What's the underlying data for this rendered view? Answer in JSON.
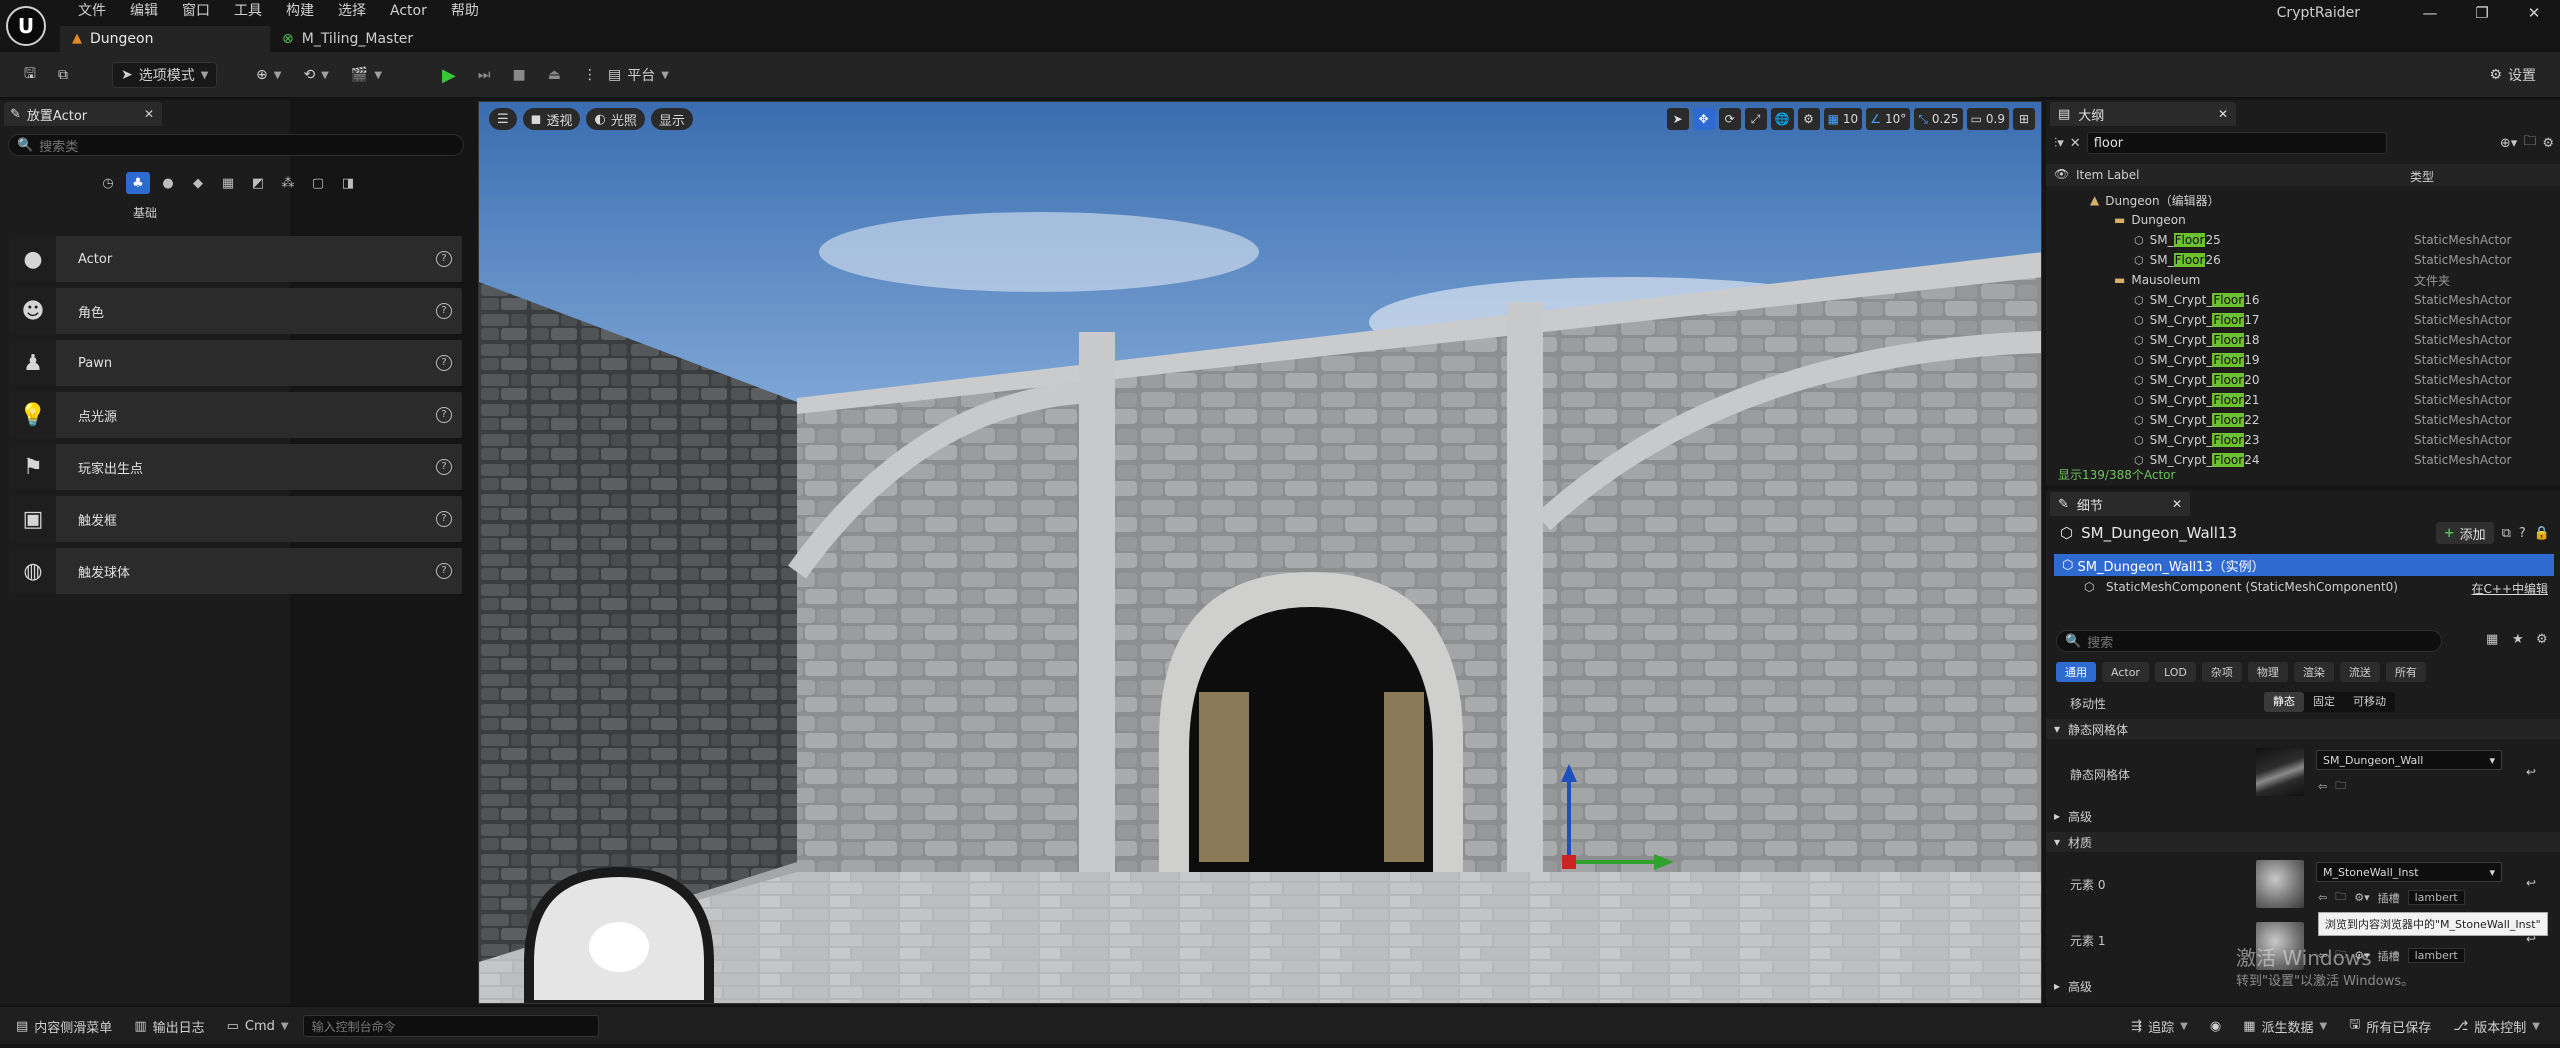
{
  "titlebar": {
    "logo": "U",
    "menu": [
      "文件",
      "编辑",
      "窗口",
      "工具",
      "构建",
      "选择",
      "Actor",
      "帮助"
    ],
    "app_name": "CryptRaider",
    "window_controls": [
      "—",
      "❐",
      "✕"
    ]
  },
  "tabs": [
    {
      "label": "Dungeon",
      "icon": "level-icon"
    },
    {
      "label": "M_Tiling_Master",
      "icon": "material-icon"
    }
  ],
  "toolbar": {
    "mode_label": "选项模式",
    "platform_label": "平台",
    "settings_label": "设置"
  },
  "place_actors": {
    "tab_label": "放置Actor",
    "search_placeholder": "搜索类",
    "category": "基础",
    "items": [
      {
        "label": "Actor",
        "icon": "sphere-icon"
      },
      {
        "label": "角色",
        "icon": "character-icon"
      },
      {
        "label": "Pawn",
        "icon": "pawn-icon"
      },
      {
        "label": "点光源",
        "icon": "point-light-icon"
      },
      {
        "label": "玩家出生点",
        "icon": "player-start-icon"
      },
      {
        "label": "触发框",
        "icon": "trigger-box-icon"
      },
      {
        "label": "触发球体",
        "icon": "trigger-sphere-icon"
      }
    ]
  },
  "viewport": {
    "perspective_label": "透视",
    "lighting_label": "光照",
    "show_label": "显示",
    "grid_snap": "10",
    "rotation_snap": "10°",
    "scale_snap": "0.25",
    "camera_speed": "0.9"
  },
  "outliner": {
    "tab_label": "大纲",
    "filter_value": "floor",
    "col_label": "Item Label",
    "col_type": "类型",
    "root": "Dungeon（编辑器）",
    "rows": [
      {
        "pre": "",
        "hl": "",
        "post": "Dungeon",
        "type": "",
        "kind": "folder",
        "indent": 1
      },
      {
        "pre": "SM_",
        "hl": "Floor",
        "post": "25",
        "type": "StaticMeshActor",
        "kind": "mesh",
        "indent": 2
      },
      {
        "pre": "SM_",
        "hl": "Floor",
        "post": "26",
        "type": "StaticMeshActor",
        "kind": "mesh",
        "indent": 2
      },
      {
        "pre": "",
        "hl": "",
        "post": "Mausoleum",
        "type": "文件夹",
        "kind": "folder",
        "indent": 1
      },
      {
        "pre": "SM_Crypt_",
        "hl": "Floor",
        "post": "16",
        "type": "StaticMeshActor",
        "kind": "mesh",
        "indent": 2
      },
      {
        "pre": "SM_Crypt_",
        "hl": "Floor",
        "post": "17",
        "type": "StaticMeshActor",
        "kind": "mesh",
        "indent": 2
      },
      {
        "pre": "SM_Crypt_",
        "hl": "Floor",
        "post": "18",
        "type": "StaticMeshActor",
        "kind": "mesh",
        "indent": 2
      },
      {
        "pre": "SM_Crypt_",
        "hl": "Floor",
        "post": "19",
        "type": "StaticMeshActor",
        "kind": "mesh",
        "indent": 2
      },
      {
        "pre": "SM_Crypt_",
        "hl": "Floor",
        "post": "20",
        "type": "StaticMeshActor",
        "kind": "mesh",
        "indent": 2
      },
      {
        "pre": "SM_Crypt_",
        "hl": "Floor",
        "post": "21",
        "type": "StaticMeshActor",
        "kind": "mesh",
        "indent": 2
      },
      {
        "pre": "SM_Crypt_",
        "hl": "Floor",
        "post": "22",
        "type": "StaticMeshActor",
        "kind": "mesh",
        "indent": 2
      },
      {
        "pre": "SM_Crypt_",
        "hl": "Floor",
        "post": "23",
        "type": "StaticMeshActor",
        "kind": "mesh",
        "indent": 2
      },
      {
        "pre": "SM_Crypt_",
        "hl": "Floor",
        "post": "24",
        "type": "StaticMeshActor",
        "kind": "mesh",
        "indent": 2
      }
    ],
    "footer": "显示139/388个Actor"
  },
  "details": {
    "tab_label": "细节",
    "object_name": "SM_Dungeon_Wall13",
    "add_label": "添加",
    "instance_label": "SM_Dungeon_Wall13（实例）",
    "component_label": "StaticMeshComponent (StaticMeshComponent0)",
    "edit_in_cpp": "在C++中编辑",
    "search_placeholder": "搜索",
    "categories": [
      "通用",
      "Actor",
      "LOD",
      "杂项",
      "物理",
      "渲染",
      "流送",
      "所有"
    ],
    "mobility_label": "移动性",
    "mobility_options": [
      "静态",
      "固定",
      "可移动"
    ],
    "static_mesh_section": "静态网格体",
    "static_mesh_label": "静态网格体",
    "static_mesh_value": "SM_Dungeon_Wall",
    "advanced_label": "高级",
    "materials_section": "材质",
    "element0_label": "元素 0",
    "element0_value": "M_StoneWall_Inst",
    "element1_label": "元素 1",
    "slot_label": "插槽",
    "slot_value": "lambert",
    "tooltip": "浏览到内容浏览器中的\"M_StoneWall_Inst\"",
    "advanced2_label": "高级"
  },
  "watermark": {
    "line1": "激活 Windows",
    "line2": "转到\"设置\"以激活 Windows。"
  },
  "statusbar": {
    "content_drawer": "内容侧滑菜单",
    "output_log": "输出日志",
    "cmd": "Cmd",
    "console_placeholder": "输入控制台命令",
    "trace": "追踪",
    "derived_data": "派生数据",
    "saved": "所有已保存",
    "source_control": "版本控制"
  }
}
